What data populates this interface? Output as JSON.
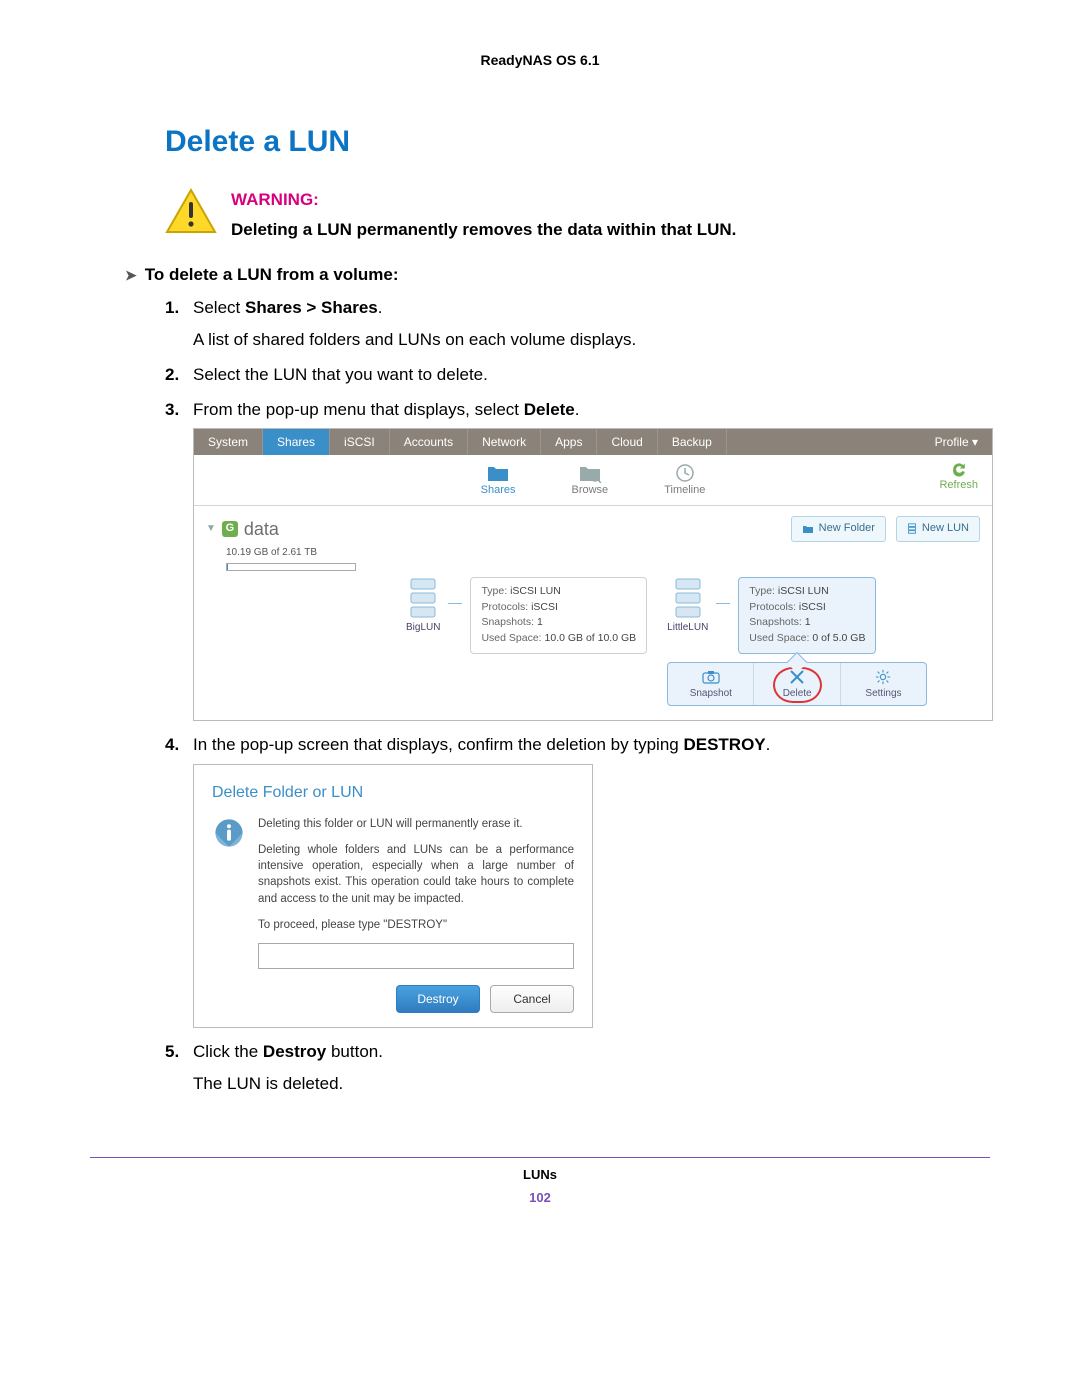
{
  "doc_header": "ReadyNAS OS 6.1",
  "section_title": "Delete a LUN",
  "warning": {
    "label": "WARNING:",
    "text": "Deleting a LUN permanently removes the data within that LUN."
  },
  "procedure_title": "To delete a LUN from a volume:",
  "steps": {
    "s1_pre": "Select ",
    "s1_bold": "Shares > Shares",
    "s1_post": ".",
    "s1_sub": "A list of shared folders and LUNs on each volume displays.",
    "s2": "Select the LUN that you want to delete.",
    "s3_pre": "From the pop-up menu that displays, select ",
    "s3_bold": "Delete",
    "s3_post": ".",
    "s4_pre": "In the pop-up screen that displays, confirm the deletion by typing ",
    "s4_bold": "DESTROY",
    "s4_post": ".",
    "s5_pre": "Click the ",
    "s5_bold": "Destroy",
    "s5_post": " button.",
    "s5_sub": "The LUN is deleted."
  },
  "ui_shares": {
    "tabs": [
      "System",
      "Shares",
      "iSCSI",
      "Accounts",
      "Network",
      "Apps",
      "Cloud",
      "Backup"
    ],
    "profile": "Profile ▾",
    "subnav": {
      "shares": "Shares",
      "browse": "Browse",
      "timeline": "Timeline",
      "refresh": "Refresh"
    },
    "volume": {
      "name": "data",
      "usage": "10.19 GB of 2.61 TB"
    },
    "buttons": {
      "new_folder": "New Folder",
      "new_lun": "New LUN"
    },
    "luns": [
      {
        "name": "BigLUN",
        "type_label": "Type:",
        "type": "iSCSI LUN",
        "proto_label": "Protocols:",
        "proto": "iSCSI",
        "snap_label": "Snapshots:",
        "snap": "1",
        "used_label": "Used Space:",
        "used": "10.0 GB of 10.0 GB"
      },
      {
        "name": "LittleLUN",
        "type_label": "Type:",
        "type": "iSCSI LUN",
        "proto_label": "Protocols:",
        "proto": "iSCSI",
        "snap_label": "Snapshots:",
        "snap": "1",
        "used_label": "Used Space:",
        "used": "0 of 5.0 GB"
      }
    ],
    "popup": {
      "snapshot": "Snapshot",
      "delete": "Delete",
      "settings": "Settings"
    }
  },
  "ui_dialog": {
    "title": "Delete Folder or LUN",
    "p1": "Deleting this folder or LUN will permanently erase it.",
    "p2": "Deleting whole folders and LUNs can be a performance intensive operation, especially when a large number of snapshots exist. This operation could take hours to complete and access to the unit may be impacted.",
    "p3": "To proceed, please type \"DESTROY\"",
    "destroy": "Destroy",
    "cancel": "Cancel"
  },
  "footer": {
    "label": "LUNs",
    "page": "102"
  }
}
